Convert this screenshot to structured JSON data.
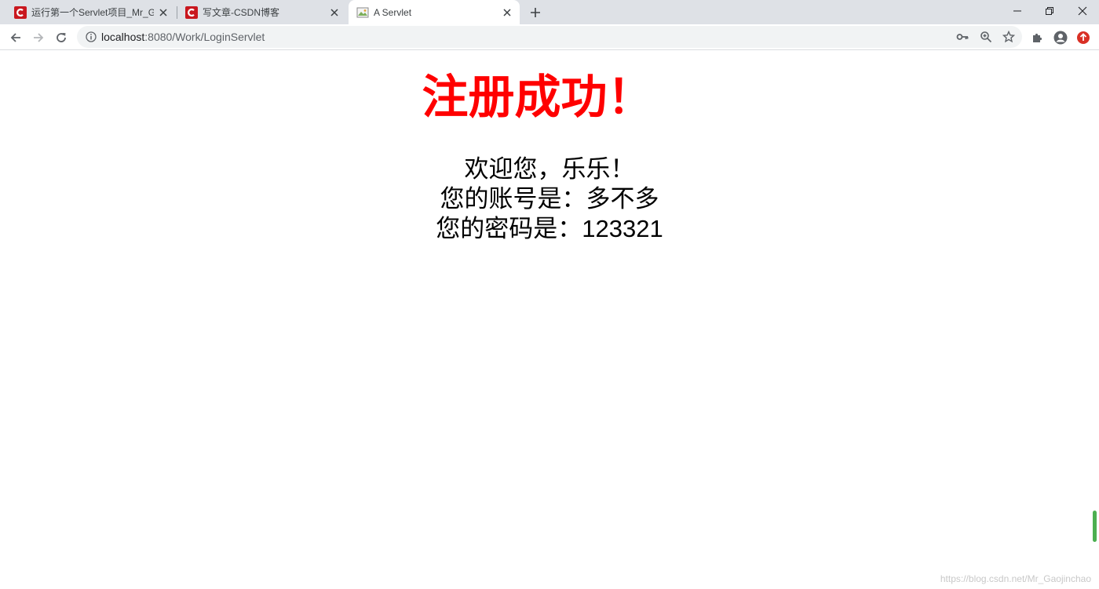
{
  "tabs": [
    {
      "title": "运行第一个Servlet项目_Mr_Gao",
      "favicon": "csdn-logo-icon",
      "active": false
    },
    {
      "title": "写文章-CSDN博客",
      "favicon": "csdn-logo-icon",
      "active": false
    },
    {
      "title": "A Servlet",
      "favicon": "broken-image-icon",
      "active": true
    }
  ],
  "toolbar": {
    "url_host": "localhost",
    "url_path": ":8080/Work/LoginServlet"
  },
  "page": {
    "heading": "注册成功！",
    "welcome": "欢迎您，乐乐！",
    "account": "您的账号是：多不多",
    "password": "您的密码是：123321"
  },
  "watermark": "https://blog.csdn.net/Mr_Gaojinchao",
  "colors": {
    "heading": "#ff0000",
    "csdn_brand": "#c9171e",
    "tab_strip": "#dee1e6",
    "omnibox": "#f1f3f4",
    "scroll_thumb": "#4caf50"
  }
}
